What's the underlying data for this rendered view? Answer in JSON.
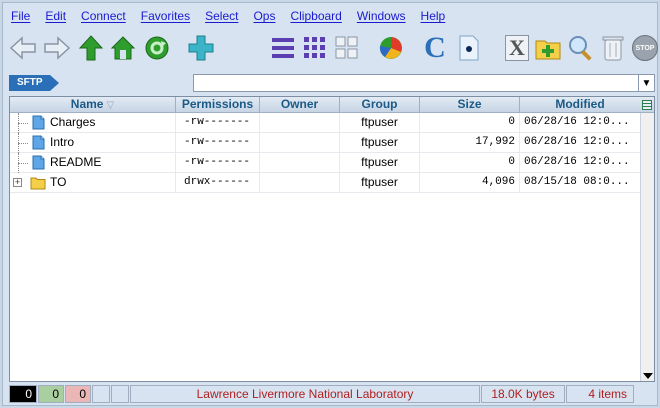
{
  "menu": [
    "File",
    "Edit",
    "Connect",
    "Favorites",
    "Select",
    "Ops",
    "Clipboard",
    "Windows",
    "Help"
  ],
  "toolbar": {
    "icons": [
      "back-arrow-icon",
      "forward-arrow-icon",
      "up-arrow-icon",
      "home-icon",
      "refresh-icon",
      "connect-plus-icon",
      "list-view-icon",
      "icon-view-icon",
      "small-icons-view-icon",
      "pie-chart-icon",
      "c-letter-icon",
      "file-info-icon",
      "x-letter-icon",
      "new-folder-icon",
      "search-icon",
      "trash-icon",
      "stop-icon"
    ],
    "stop_label": "STOP",
    "c_label": "C",
    "x_label": "X"
  },
  "pathbar": {
    "protocol": "SFTP",
    "path_value": ""
  },
  "table": {
    "columns": [
      "Name",
      "Permissions",
      "Owner",
      "Group",
      "Size",
      "Modified"
    ],
    "sort_indicator": "▽",
    "rows": [
      {
        "name": "Charges",
        "permissions": "-rw-------",
        "owner": "",
        "group": "ftpuser",
        "size": "0",
        "modified": "06/28/16 12:0...",
        "type": "file"
      },
      {
        "name": "Intro",
        "permissions": "-rw-------",
        "owner": "",
        "group": "ftpuser",
        "size": "17,992",
        "modified": "06/28/16 12:0...",
        "type": "file"
      },
      {
        "name": "README",
        "permissions": "-rw-------",
        "owner": "",
        "group": "ftpuser",
        "size": "0",
        "modified": "06/28/16 12:0...",
        "type": "file"
      },
      {
        "name": "TO",
        "permissions": "drwx------",
        "owner": "",
        "group": "ftpuser",
        "size": "4,096",
        "modified": "08/15/18 08:0...",
        "type": "folder"
      }
    ]
  },
  "status": {
    "count_black": "0",
    "count_green": "0",
    "count_pink": "0",
    "message": "Lawrence Livermore National Laboratory",
    "bytes": "18.0K bytes",
    "items": "4 items"
  },
  "colors": {
    "menu_text": "#1a1ad0",
    "header_text": "#1b5a86",
    "status_text": "#b01f1f",
    "sftp_badge": "#2a6fb8"
  }
}
